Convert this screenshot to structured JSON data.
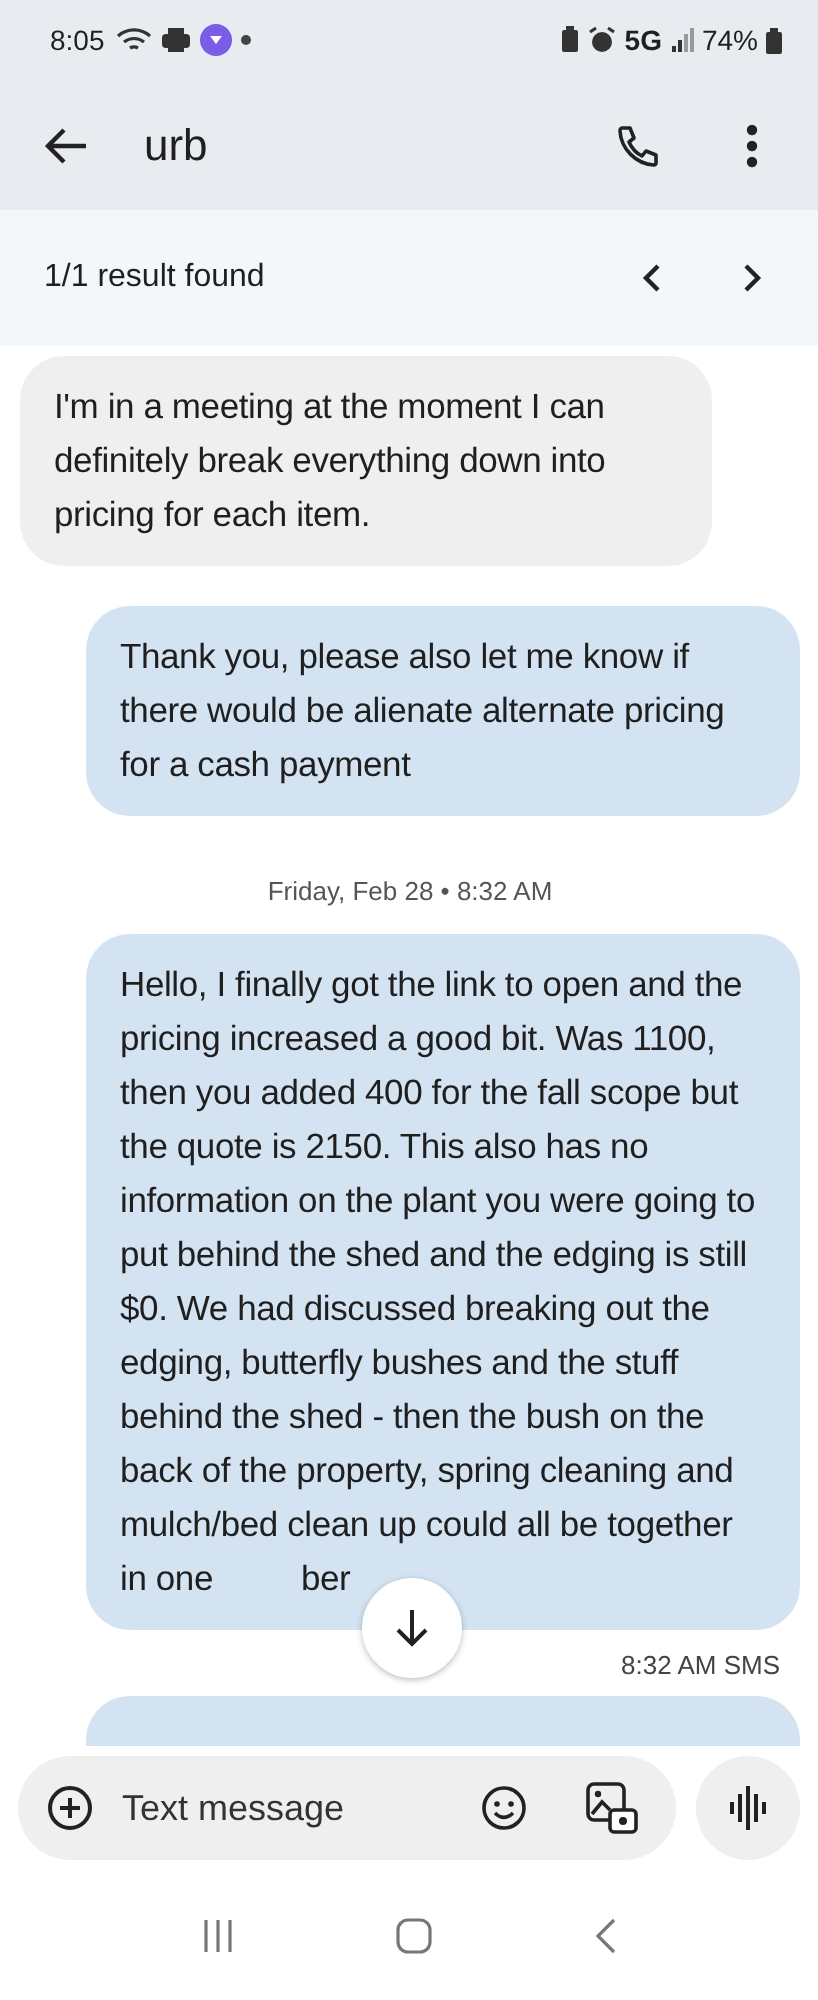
{
  "status_bar": {
    "time": "8:05",
    "network": "5G",
    "battery": "74%"
  },
  "header": {
    "title": "urb"
  },
  "search_results": {
    "text": "1/1 result found"
  },
  "messages": [
    {
      "kind": "incoming",
      "text": "I'm in a meeting at the moment I can definitely break everything down into pricing for each item."
    },
    {
      "kind": "outgoing",
      "text": "Thank you,  please also let me know if there would be alienate alternate pricing for a cash payment"
    },
    {
      "kind": "date",
      "text": "Friday, Feb 28 • 8:32 AM"
    },
    {
      "kind": "outgoing",
      "text": "Hello, I finally got the link to open and the pricing increased a good bit. Was 1100, then you added 400 for the fall scope but the quote is 2150. This also has no information on the plant you were going to put behind the shed and the edging is still $0. We had discussed breaking out the edging, butterfly bushes and the stuff behind the shed - then the bush on the back of the property, spring cleaning and mulch/bed clean up could all be together in one",
      "covered_tail": "ber"
    },
    {
      "kind": "meta",
      "text": "8:32 AM SMS"
    },
    {
      "kind": "partial"
    }
  ],
  "composer": {
    "placeholder": "Text message"
  }
}
